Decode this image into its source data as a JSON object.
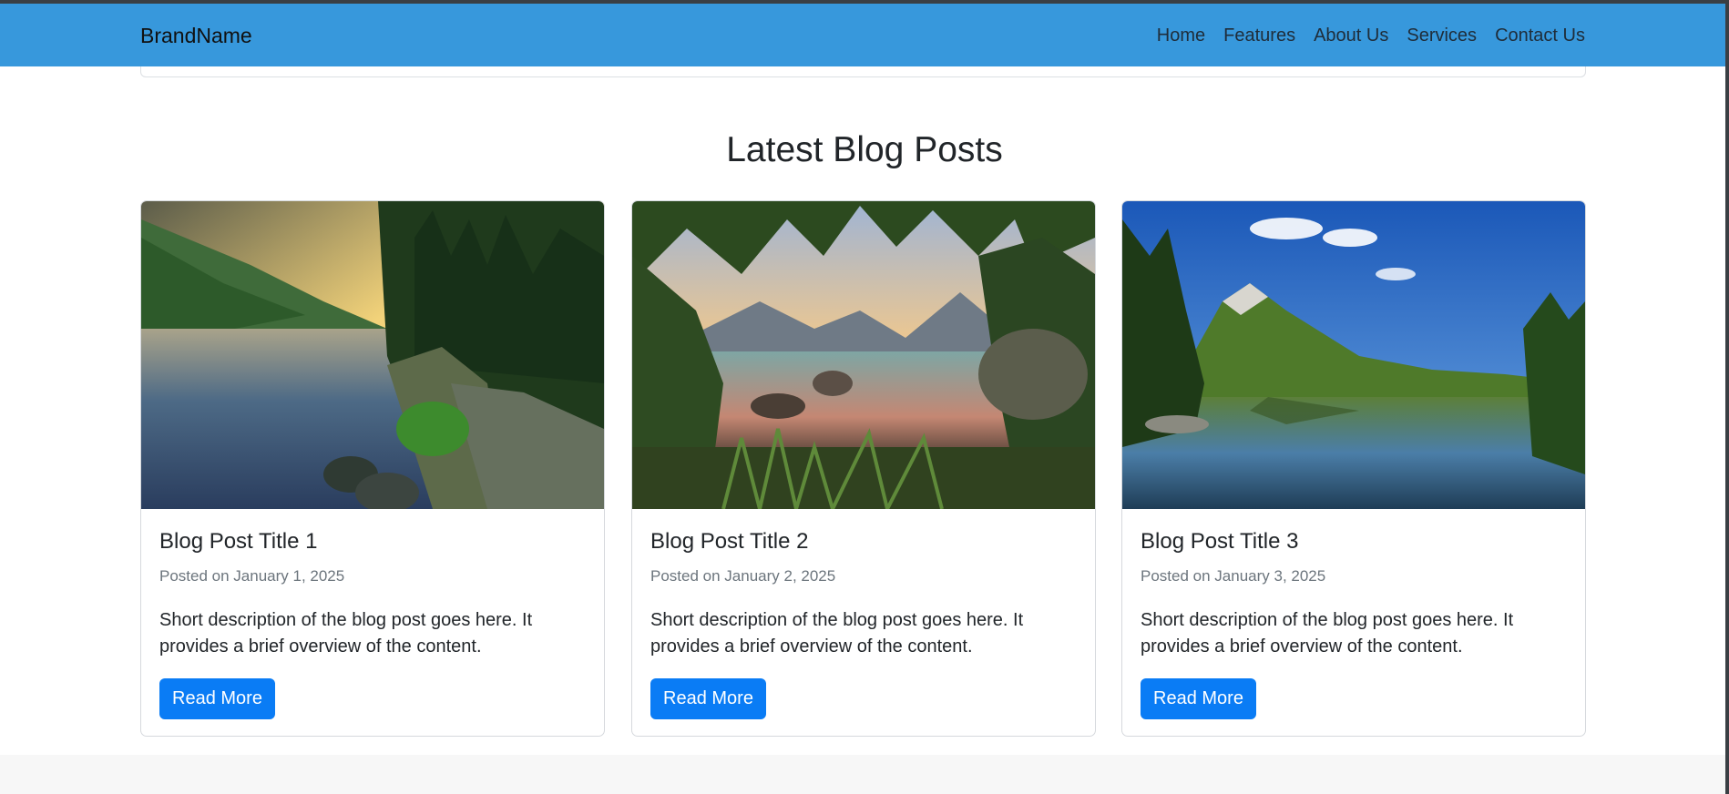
{
  "navbar": {
    "brand": "BrandName",
    "links": [
      "Home",
      "Features",
      "About Us",
      "Services",
      "Contact Us"
    ],
    "background": "#3798dc"
  },
  "section": {
    "title": "Latest Blog Posts"
  },
  "posts": [
    {
      "title": "Blog Post Title 1",
      "date": "Posted on January 1, 2025",
      "description": "Short description of the blog post goes here. It provides a brief overview of the content.",
      "button": "Read More",
      "image": "lake-forest-sunset-photo"
    },
    {
      "title": "Blog Post Title 2",
      "date": "Posted on January 2, 2025",
      "description": "Short description of the blog post goes here. It provides a brief overview of the content.",
      "button": "Read More",
      "image": "mountain-lake-sunrise-photo"
    },
    {
      "title": "Blog Post Title 3",
      "date": "Posted on January 3, 2025",
      "description": "Short description of the blog post goes here. It provides a brief overview of the content.",
      "button": "Read More",
      "image": "alpine-lake-reflection-photo"
    }
  ],
  "colors": {
    "button": "#0a7cf5",
    "muted_text": "#6c757d"
  }
}
